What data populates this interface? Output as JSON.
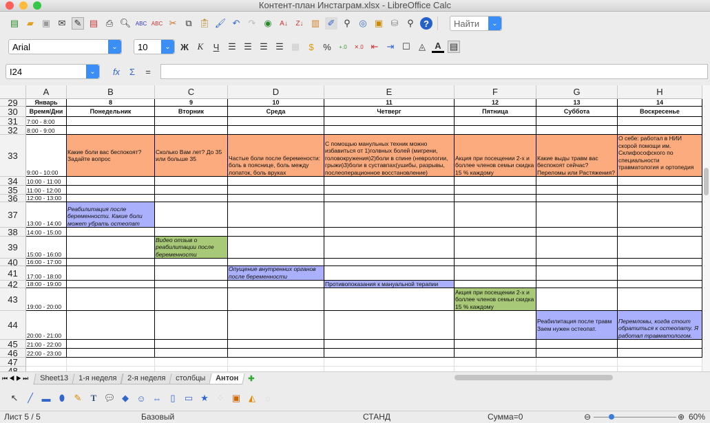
{
  "window": {
    "title": "Контент-план  Инстаграм.xlsx - LibreOffice Calc"
  },
  "toolbar": {
    "find_placeholder": "Найти",
    "font_name": "Arial",
    "font_size": "10",
    "bold": "Ж",
    "italic": "К",
    "underline": "Ч"
  },
  "formula_bar": {
    "cell_ref": "I24",
    "value": "",
    "fx": "fx",
    "sum": "Σ",
    "equals": "="
  },
  "columns": [
    "A",
    "B",
    "C",
    "D",
    "E",
    "F",
    "G",
    "H"
  ],
  "colors": {
    "orange": "#fbab7e",
    "blue": "#aab0fb",
    "green": "#a8c977"
  },
  "rows": [
    {
      "num": "29",
      "type": "header",
      "cells": {
        "A": "Январь",
        "B": "8",
        "C": "9",
        "D": "10",
        "E": "11",
        "F": "12",
        "G": "13",
        "H": "14"
      }
    },
    {
      "num": "30",
      "type": "header",
      "cells": {
        "A": "Время/Дни",
        "B": "Понедельник",
        "C": "Вторник",
        "D": "Среда",
        "E": "Четверг",
        "F": "Пятница",
        "G": "Суббота",
        "H": "Воскресенье"
      }
    },
    {
      "num": "31",
      "cells": {
        "A": "7:00 - 8:00"
      }
    },
    {
      "num": "32",
      "cells": {
        "A": "8:00 - 9:00"
      }
    },
    {
      "num": "33",
      "cells": {
        "A": "9:00 - 10:00",
        "B": {
          "text": "Какие боли вас беспокоят? Задайте  вопрос",
          "fill": "orange",
          "valign": "center"
        },
        "C": {
          "text": "Сколько Вам лет? До 35 или больше 35",
          "fill": "orange",
          "valign": "center"
        },
        "D": {
          "text": "Частые боли после беремености: боль в пояснице, боль между лопаток, боль  вруках",
          "fill": "orange"
        },
        "E": {
          "text": "С помощью манульных техник можно избавиться от 1)голвных болей (мигрени, головокружения)2)боли в спине (неврологии, грыжи)3)боли в суставпах(ушибы,  разрывы, послеоперационное  восстановление)",
          "fill": "orange"
        },
        "F": {
          "text": "Акция при посещении 2-х и боллее членов семьи скидка 15 % каждому",
          "fill": "orange"
        },
        "G": {
          "text": "Какие выды травм вас беспокоят сейчас? Переломы или Растяжения?",
          "fill": "orange"
        },
        "H": {
          "text": "О себе: работал в НИИ скорой помощи им. Склифософского по специальности травматология  и  ортопедия",
          "fill": "orange",
          "valign": "top"
        }
      }
    },
    {
      "num": "34",
      "cells": {
        "A": "10:00 - 11:00"
      }
    },
    {
      "num": "35",
      "cells": {
        "A": "11:00 - 12:00"
      }
    },
    {
      "num": "36",
      "cells": {
        "A": "12:00 - 13:00"
      }
    },
    {
      "num": "37",
      "cells": {
        "A": "13:00 - 14:00",
        "B": {
          "text": "Реабилитация после беременности. Какие боли может  убрать  остеопат",
          "fill": "blue",
          "italic": true
        }
      }
    },
    {
      "num": "38",
      "cells": {
        "A": "14:00 - 15:00"
      }
    },
    {
      "num": "39",
      "cells": {
        "A": "15:00 - 16:00",
        "C": {
          "text": "Видео отзыв о реабилитации после беременности",
          "fill": "green",
          "italic": true
        }
      }
    },
    {
      "num": "40",
      "cells": {
        "A": "16:00 - 17:00"
      }
    },
    {
      "num": "41",
      "cells": {
        "A": "17:00 - 18:00",
        "D": {
          "text": "Опущение внутренних органов  после  беременности",
          "fill": "blue",
          "italic": true
        }
      }
    },
    {
      "num": "42",
      "cells": {
        "A": "18:00 - 19:00",
        "E": {
          "text": "Противопоказания к мануальной терапии",
          "fill": "blue"
        }
      }
    },
    {
      "num": "43",
      "cells": {
        "A": "19:00 - 20:00",
        "F": {
          "text": "Акция  при  посещении  2-х и боллее членов семьи скидка  15  %  каждому",
          "fill": "green"
        }
      }
    },
    {
      "num": "44",
      "cells": {
        "A": "20:00 - 21:00",
        "G": {
          "text": "Реабилитация после травм Заем нужен остеопат.",
          "fill": "blue",
          "valign": "center"
        },
        "H": {
          "text": "Перемломы,  когда  стоит обратиться к остеопату. Я работал травматологом.",
          "fill": "blue",
          "italic": true
        }
      }
    },
    {
      "num": "45",
      "cells": {
        "A": "21:00 - 22:00"
      }
    },
    {
      "num": "46",
      "cells": {
        "A": "22:00 - 23:00"
      }
    },
    {
      "num": "47",
      "type": "empty",
      "cells": {}
    },
    {
      "num": "48",
      "type": "empty",
      "cells": {}
    }
  ],
  "sheet_tabs": [
    "Sheet13",
    "1-я неделя",
    "2-я неделя",
    "столбцы",
    "Антон"
  ],
  "active_tab": "Антон",
  "statusbar": {
    "sheet": "Лист 5 / 5",
    "style": "Базовый",
    "mode": "СТАНД",
    "sum": "Сумма=0",
    "zoom": "60%"
  }
}
